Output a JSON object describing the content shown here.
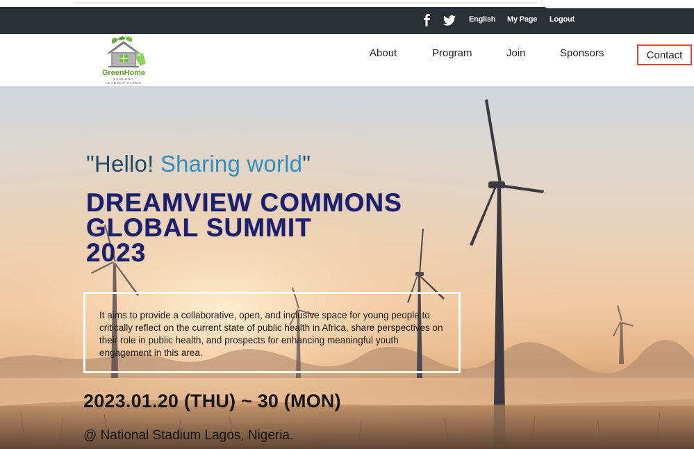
{
  "utility_bar": {
    "icons": [
      "facebook-icon",
      "twitter-icon"
    ],
    "language": "English",
    "my_page": "My Page",
    "logout": "Logout"
  },
  "logo": {
    "name": "GreenHome",
    "tagline": "ECOLOGY",
    "sub": "LEADWAY FARMS"
  },
  "nav": {
    "items": [
      "About",
      "Program",
      "Join",
      "Sponsors",
      "Contact"
    ]
  },
  "hero": {
    "hello_open": "\"Hello! ",
    "hello_accent": "Sharing world",
    "hello_close": "\"",
    "title_line1": "DREAMVIEW COMMONS",
    "title_line2": "GLOBAL SUMMIT",
    "title_line3": "2023",
    "description": "It aims to provide a collaborative, open, and inclusive space for young people to critically reflect on the current state of public health in Africa, share perspectives on their role in public health, and prospects for enhancing meaningful youth engagement in this area.",
    "dates": "2023.01.20 (THU) ~ 30 (MON)",
    "venue": "@ National Stadium Lagos, Nigeria."
  },
  "colors": {
    "utility_bar_bg": "#2b2f36",
    "contact_border": "#d9473b",
    "logo_green": "#5aa02c",
    "title_navy": "#1a1f6e"
  }
}
